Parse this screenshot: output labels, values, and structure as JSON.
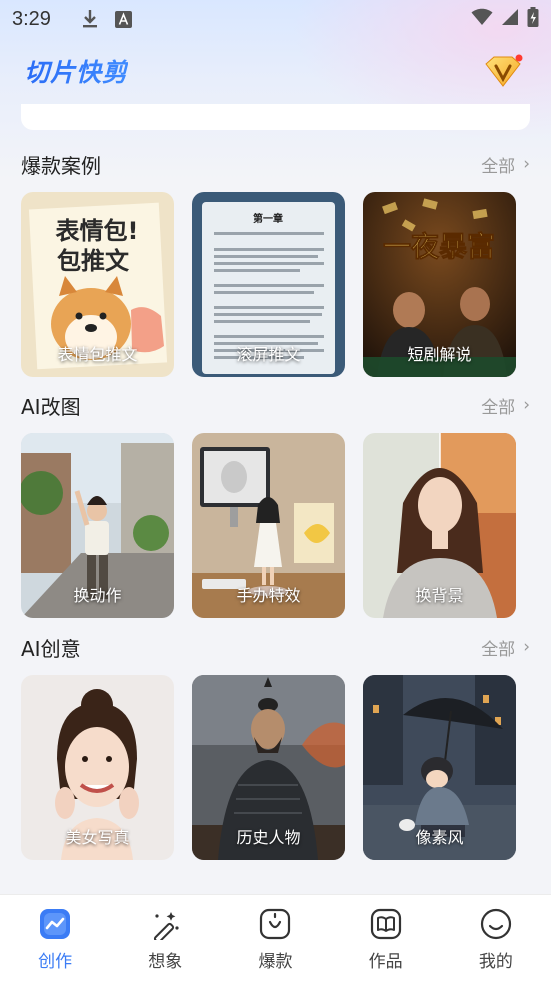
{
  "status_bar": {
    "time": "3:29"
  },
  "app": {
    "title": "切片快剪"
  },
  "sections": [
    {
      "title": "爆款案例",
      "more": "全部",
      "cards": [
        {
          "label": "表情包推文",
          "headline": "表情包！包推文"
        },
        {
          "label": "滚屏推文",
          "page_title": "第一章"
        },
        {
          "label": "短剧解说",
          "headline": "一夜暴富"
        }
      ]
    },
    {
      "title": "AI改图",
      "more": "全部",
      "cards": [
        {
          "label": "换动作"
        },
        {
          "label": "手办特效"
        },
        {
          "label": "换背景"
        }
      ]
    },
    {
      "title": "AI创意",
      "more": "全部",
      "cards": [
        {
          "label": "美女写真"
        },
        {
          "label": "历史人物"
        },
        {
          "label": "像素风"
        }
      ]
    }
  ],
  "tabs": [
    {
      "label": "创作",
      "icon": "create-icon",
      "active": true
    },
    {
      "label": "想象",
      "icon": "magic-wand-icon",
      "active": false
    },
    {
      "label": "爆款",
      "icon": "hot-icon",
      "active": false
    },
    {
      "label": "作品",
      "icon": "book-icon",
      "active": false
    },
    {
      "label": "我的",
      "icon": "smile-icon",
      "active": false
    }
  ],
  "colors": {
    "accent": "#3b7cf5",
    "background": "#f3f4f8"
  }
}
